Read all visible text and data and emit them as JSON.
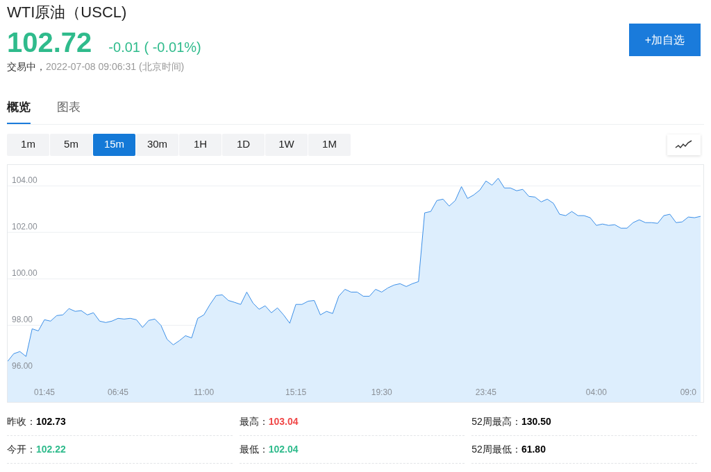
{
  "header": {
    "title": "WTI原油（USCL)",
    "price": "102.72",
    "change": "-0.01 ( -0.01%)",
    "color": "#2fbb8c",
    "status": "交易中，",
    "timestamp": "2022-07-08 09:06:31 (北京时间)",
    "watch_button": "+加自选"
  },
  "tabs": [
    {
      "label": "概览",
      "selected": true
    },
    {
      "label": "图表",
      "selected": false
    }
  ],
  "intervals": [
    {
      "label": "1m",
      "selected": false
    },
    {
      "label": "5m",
      "selected": false
    },
    {
      "label": "15m",
      "selected": true
    },
    {
      "label": "30m",
      "selected": false
    },
    {
      "label": "1H",
      "selected": false
    },
    {
      "label": "1D",
      "selected": false
    },
    {
      "label": "1W",
      "selected": false
    },
    {
      "label": "1M",
      "selected": false
    }
  ],
  "chart": {
    "chart_data": {
      "type": "area",
      "grid": true,
      "ylim": [
        94.7,
        104.9
      ],
      "yticks": [
        {
          "value": 96,
          "label": "96.00"
        },
        {
          "value": 98,
          "label": "98.00"
        },
        {
          "value": 100,
          "label": "100.00"
        },
        {
          "value": 102,
          "label": "102.00"
        },
        {
          "value": 104,
          "label": "104.00"
        }
      ],
      "categories": [
        null,
        null,
        null,
        null,
        null,
        null,
        "01:45",
        null,
        null,
        null,
        null,
        null,
        null,
        null,
        null,
        null,
        null,
        null,
        "06:45",
        null,
        null,
        null,
        null,
        null,
        null,
        null,
        null,
        null,
        null,
        null,
        null,
        null,
        "11:00",
        null,
        null,
        null,
        null,
        null,
        null,
        null,
        null,
        null,
        null,
        null,
        null,
        null,
        null,
        "15:15",
        null,
        null,
        null,
        null,
        null,
        null,
        null,
        null,
        null,
        null,
        null,
        null,
        null,
        "19:30",
        null,
        null,
        null,
        null,
        null,
        null,
        null,
        null,
        null,
        null,
        null,
        null,
        null,
        null,
        null,
        null,
        "23:45",
        null,
        null,
        null,
        null,
        null,
        null,
        null,
        null,
        null,
        null,
        null,
        null,
        null,
        null,
        null,
        null,
        null,
        "04:00",
        null,
        null,
        null,
        null,
        null,
        null,
        null,
        null,
        null,
        null,
        null,
        null,
        null,
        null,
        "09:0",
        null,
        null
      ],
      "series": [
        {
          "color": "#3b8fe8",
          "values": [
            96.45,
            96.78,
            96.87,
            96.66,
            97.85,
            97.76,
            98.24,
            98.18,
            98.42,
            98.45,
            98.72,
            98.6,
            98.63,
            98.45,
            98.54,
            98.18,
            98.12,
            98.18,
            98.3,
            98.27,
            98.3,
            98.24,
            97.91,
            98.21,
            98.27,
            98.0,
            97.4,
            97.16,
            97.34,
            97.55,
            97.46,
            98.3,
            98.45,
            98.9,
            99.28,
            99.31,
            99.07,
            98.99,
            98.9,
            99.43,
            98.96,
            98.69,
            98.84,
            98.54,
            98.75,
            98.45,
            98.09,
            98.9,
            98.9,
            99.04,
            99.07,
            98.45,
            98.6,
            98.51,
            99.25,
            99.55,
            99.43,
            99.43,
            99.25,
            99.25,
            99.55,
            99.43,
            99.61,
            99.73,
            99.79,
            99.67,
            99.79,
            99.88,
            102.84,
            102.9,
            103.37,
            103.43,
            103.13,
            103.37,
            103.97,
            103.46,
            103.61,
            103.82,
            104.21,
            104.03,
            104.33,
            103.91,
            103.91,
            103.79,
            103.85,
            103.55,
            103.52,
            103.31,
            103.43,
            103.25,
            102.78,
            102.72,
            102.9,
            102.72,
            102.72,
            102.63,
            102.3,
            102.36,
            102.3,
            102.33,
            102.18,
            102.18,
            102.42,
            102.54,
            102.42,
            102.42,
            102.39,
            102.72,
            102.78,
            102.42,
            102.45,
            102.66,
            102.63,
            102.69
          ]
        }
      ]
    }
  },
  "stats": [
    {
      "label": "昨收：",
      "value": "102.73",
      "color": "#000000"
    },
    {
      "label": "最高：",
      "value": "103.04",
      "color": "#f04848"
    },
    {
      "label": "52周最高：",
      "value": "130.50",
      "color": "#000000"
    },
    {
      "label": "今开：",
      "value": "102.22",
      "color": "#2fbb8c"
    },
    {
      "label": "最低：",
      "value": "102.04",
      "color": "#2fbb8c"
    },
    {
      "label": "52周最低：",
      "value": "61.80",
      "color": "#000000"
    }
  ]
}
